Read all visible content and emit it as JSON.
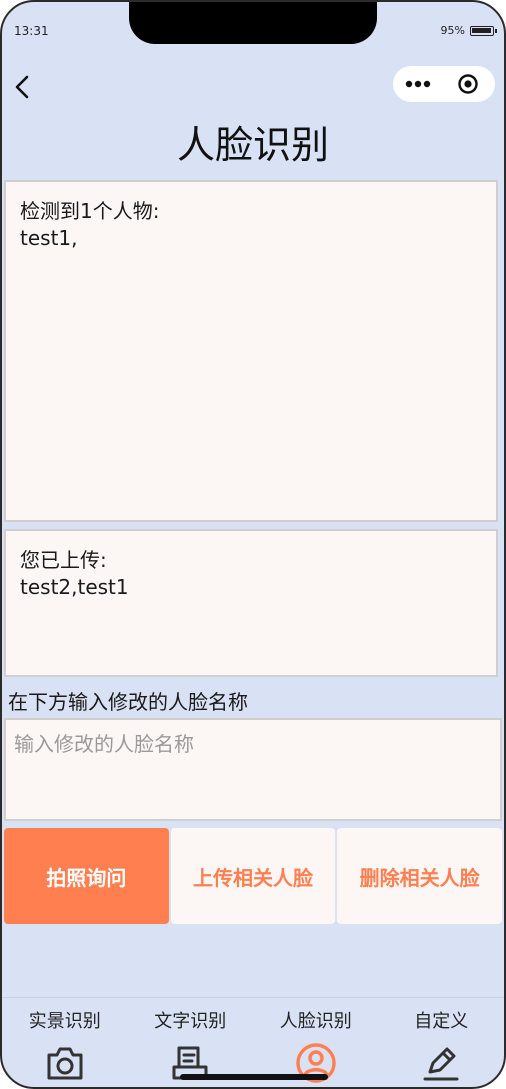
{
  "status": {
    "time": "13:31",
    "battery": "95%",
    "battery_level": 0.95
  },
  "nav": {
    "back_icon": "chevron-left-icon",
    "capsule_icons": [
      "more-dots-icon",
      "target-circle-icon"
    ]
  },
  "page": {
    "title": "人脸识别"
  },
  "detection": {
    "header": "检测到1个人物:",
    "names": "test1,"
  },
  "uploaded": {
    "header": "您已上传:",
    "names": "test2,test1"
  },
  "edit": {
    "hint": "在下方输入修改的人脸名称",
    "placeholder": "输入修改的人脸名称",
    "value": ""
  },
  "actions": [
    {
      "label": "拍照询问",
      "style": "primary"
    },
    {
      "label": "上传相关人脸",
      "style": "secondary"
    },
    {
      "label": "删除相关人脸",
      "style": "secondary"
    }
  ],
  "tabbar": {
    "items": [
      {
        "label": "实景识别",
        "icon": "camera-icon",
        "active": false
      },
      {
        "label": "文字识别",
        "icon": "document-scan-icon",
        "active": false
      },
      {
        "label": "人脸识别",
        "icon": "user-circle-icon",
        "active": true
      },
      {
        "label": "自定义",
        "icon": "pencil-icon",
        "active": false
      }
    ]
  },
  "colors": {
    "background": "#d9e2f5",
    "accent": "#ff7f50",
    "panel": "#fcf7f4"
  }
}
